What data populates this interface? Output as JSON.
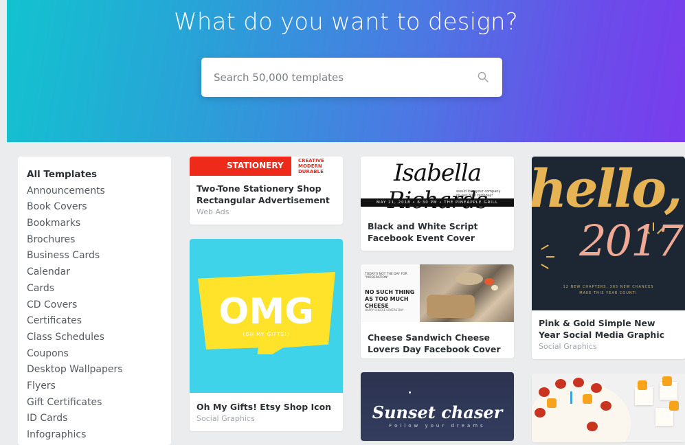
{
  "hero": {
    "title": "What do you want to design?",
    "search_placeholder": "Search 50,000 templates"
  },
  "colors": {
    "gradient_start": "#12c3cf",
    "gradient_end": "#7a3cee"
  },
  "sidebar": {
    "items": [
      "All Templates",
      "Announcements",
      "Book Covers",
      "Bookmarks",
      "Brochures",
      "Business Cards",
      "Calendar",
      "Cards",
      "CD Covers",
      "Certificates",
      "Class Schedules",
      "Coupons",
      "Desktop Wallpapers",
      "Flyers",
      "Gift Certificates",
      "ID Cards",
      "Infographics"
    ]
  },
  "cards": {
    "stationery": {
      "title": "Two-Tone Stationery Shop Rectangular Advertisement",
      "category": "Web Ads",
      "thumb_text": "STATIONERY",
      "thumb_sub": "CREATIVE MODERN DURABLE"
    },
    "omg": {
      "title": "Oh My Gifts! Etsy Shop Icon",
      "category": "Social Graphics",
      "thumb_text": "OMG",
      "thumb_sub": "(OH MY GIFTS!)"
    },
    "isabella": {
      "title": "Black and White Script Facebook Event Cover",
      "thumb_text": "Isabella Richards",
      "thumb_small": "would love your company on her 30th birthday!",
      "thumb_band": "MAY 21, 2018 • 6:30 PM • THE PINEAPPLE GRILL"
    },
    "cheese": {
      "title": "Cheese Sandwich Cheese Lovers Day Facebook Cover",
      "thumb_l1": "TODAY'S NOT THE DAY FOR \"MODERATION\"",
      "thumb_l2": "NO SUCH THING AS TOO MUCH CHEESE",
      "thumb_l3": "HAPPY CHEESE LOVERS DAY"
    },
    "hello": {
      "title": "Pink & Gold Simple New Year Social Media Graphic",
      "category": "Social Graphics",
      "thumb_hello": "hello,",
      "thumb_year": "2017",
      "thumb_small": "12 NEW CHAPTERS, 365 NEW CHANCES MAKE THIS YEAR COUNT!"
    },
    "sunset": {
      "thumb_text": "Sunset chaser",
      "thumb_sub": "Follow your dreams"
    }
  }
}
